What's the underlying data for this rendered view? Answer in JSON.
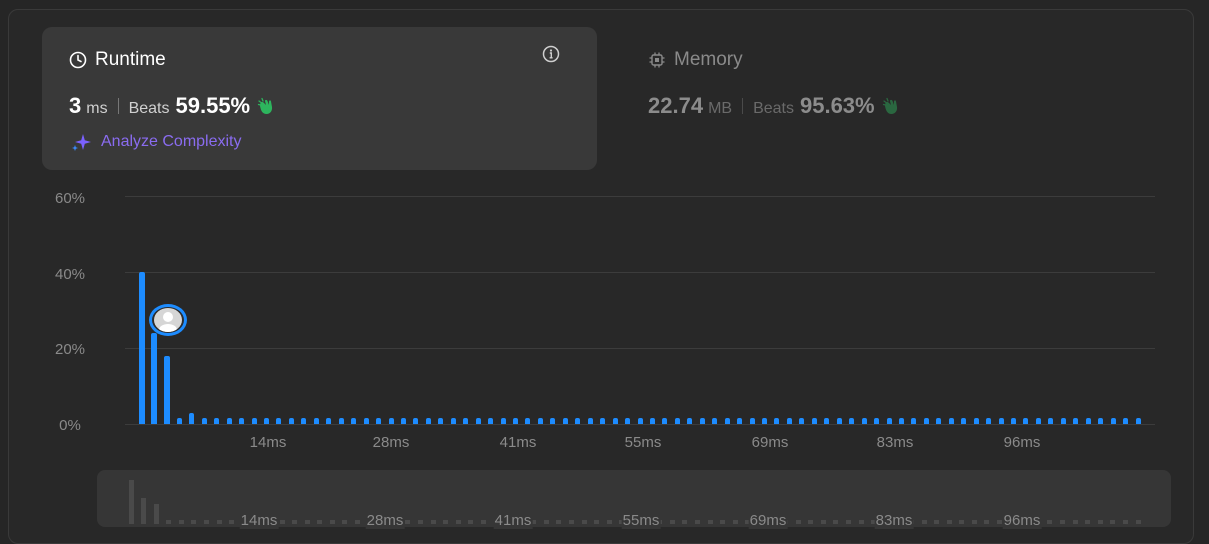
{
  "runtime": {
    "title": "Runtime",
    "value": "3",
    "unit": "ms",
    "beats_label": "Beats",
    "beats_pct": "59.55%",
    "analyze_label": "Analyze Complexity"
  },
  "memory": {
    "title": "Memory",
    "value": "22.74",
    "unit": "MB",
    "beats_label": "Beats",
    "beats_pct": "95.63%"
  },
  "colors": {
    "accent": "#1d8cff",
    "analyze": "#8a6cf0",
    "clap": "#2db55d"
  },
  "chart_data": {
    "type": "bar",
    "ylim": [
      0,
      60
    ],
    "y_ticks": [
      "60%",
      "40%",
      "20%",
      "0%"
    ],
    "x_tick_labels": [
      "14ms",
      "28ms",
      "41ms",
      "55ms",
      "69ms",
      "83ms",
      "96ms"
    ],
    "values": [
      40,
      24,
      18,
      1.5,
      3,
      1.5,
      1.5,
      1.5,
      1.5,
      1.5,
      1.5,
      1.5,
      1.5,
      1.5,
      1.5,
      1.5,
      1.5,
      1.5,
      1.5,
      1.5,
      1.5,
      1.5,
      1.5,
      1.5,
      1.5,
      1.5,
      1.5,
      1.5,
      1.5,
      1.5,
      1.5,
      1.5,
      1.5,
      1.5,
      1.5,
      1.5,
      1.5,
      1.5,
      1.5,
      1.5,
      1.5,
      1.5,
      1.5,
      1.5,
      1.5,
      1.5,
      1.5,
      1.5,
      1.5,
      1.5,
      1.5,
      1.5,
      1.5,
      1.5,
      1.5,
      1.5,
      1.5,
      1.5,
      1.5,
      1.5,
      1.5,
      1.5,
      1.5,
      1.5,
      1.5,
      1.5,
      1.5,
      1.5,
      1.5,
      1.5,
      1.5,
      1.5,
      1.5,
      1.5,
      1.5,
      1.5,
      1.5,
      1.5,
      1.5,
      1.5,
      1.5
    ],
    "highlighted_index": 1,
    "grid": true
  }
}
